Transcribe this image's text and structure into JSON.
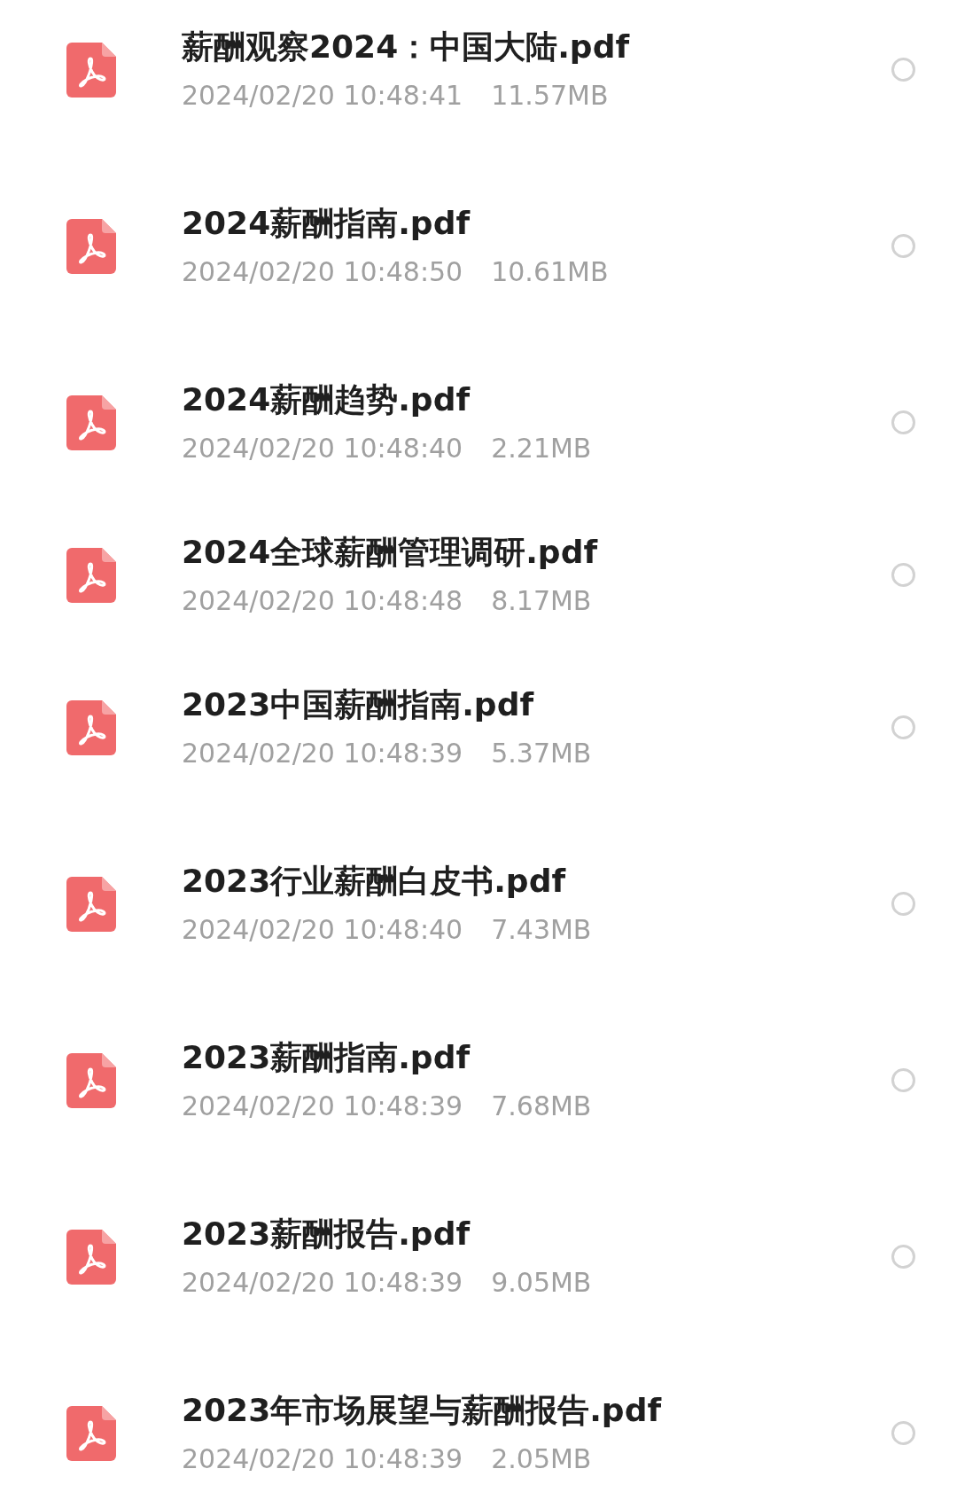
{
  "files": [
    {
      "name": "薪酬观察2024：中国大陆.pdf",
      "date": "2024/02/20 10:48:41",
      "size": "11.57MB",
      "selected": false
    },
    {
      "name": "2024薪酬指南.pdf",
      "date": "2024/02/20 10:48:50",
      "size": "10.61MB",
      "selected": false
    },
    {
      "name": "2024薪酬趋势.pdf",
      "date": "2024/02/20 10:48:40",
      "size": "2.21MB",
      "selected": false
    },
    {
      "name": "2024全球薪酬管理调研.pdf",
      "date": "2024/02/20 10:48:48",
      "size": "8.17MB",
      "selected": false
    },
    {
      "name": "2023中国薪酬指南.pdf",
      "date": "2024/02/20 10:48:39",
      "size": "5.37MB",
      "selected": false
    },
    {
      "name": "2023行业薪酬白皮书.pdf",
      "date": "2024/02/20 10:48:40",
      "size": "7.43MB",
      "selected": false
    },
    {
      "name": "2023薪酬指南.pdf",
      "date": "2024/02/20 10:48:39",
      "size": "7.68MB",
      "selected": false
    },
    {
      "name": "2023薪酬报告.pdf",
      "date": "2024/02/20 10:48:39",
      "size": "9.05MB",
      "selected": false
    },
    {
      "name": "2023年市场展望与薪酬报告.pdf",
      "date": "2024/02/20 10:48:39",
      "size": "2.05MB",
      "selected": false
    }
  ]
}
